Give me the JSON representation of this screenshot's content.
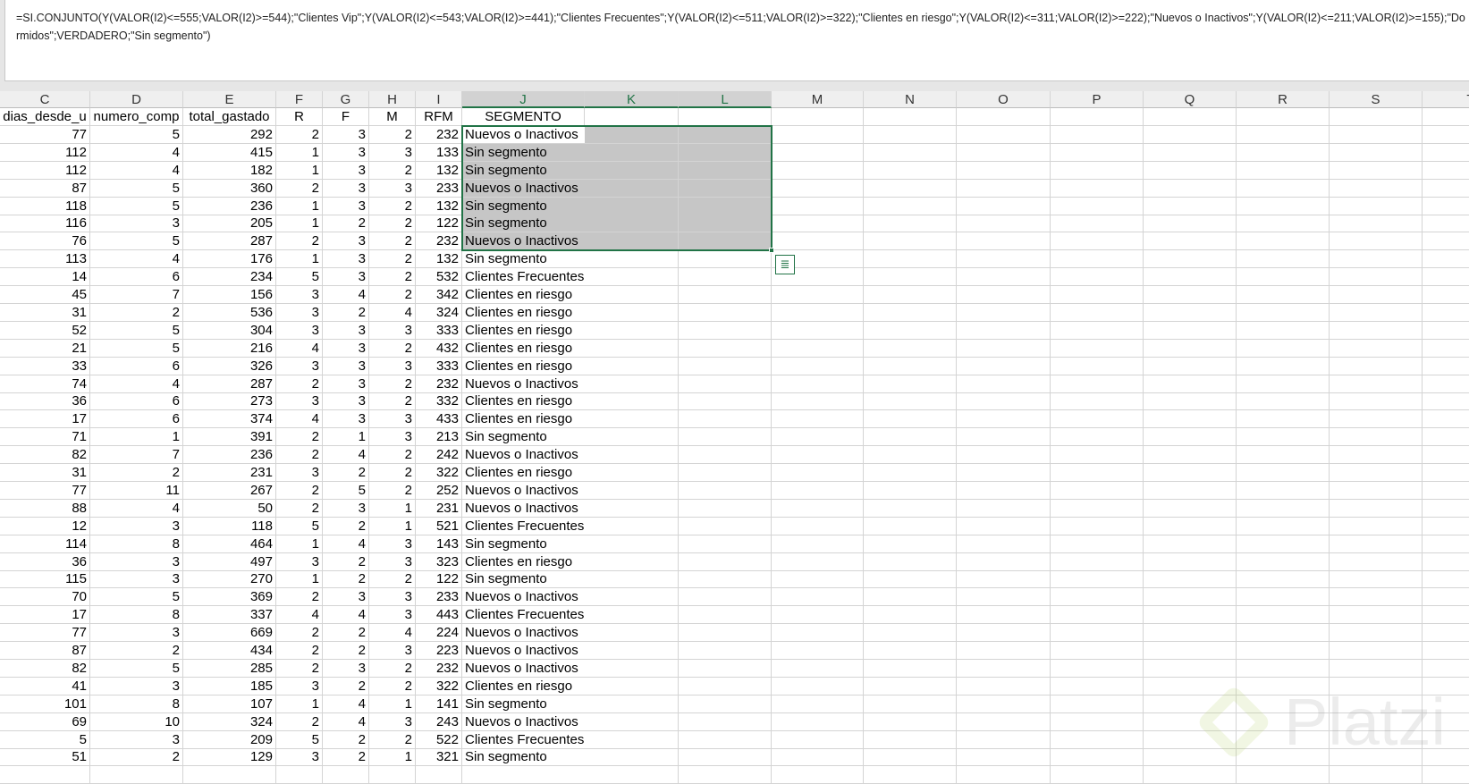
{
  "formula_bar": {
    "text": "=SI.CONJUNTO(Y(VALOR(I2)<=555;VALOR(I2)>=544);\"Clientes Vip\";Y(VALOR(I2)<=543;VALOR(I2)>=441);\"Clientes Frecuentes\";Y(VALOR(I2)<=511;VALOR(I2)>=322);\"Clientes en riesgo\";Y(VALOR(I2)<=311;VALOR(I2)>=222);\"Nuevos o Inactivos\";Y(VALOR(I2)<=211;VALOR(I2)>=155);\"Dormidos\";VERDADERO;\"Sin segmento\")"
  },
  "columns": [
    "C",
    "D",
    "E",
    "F",
    "G",
    "H",
    "I",
    "J",
    "K",
    "L",
    "M",
    "N",
    "O",
    "P",
    "Q",
    "R",
    "S",
    "T"
  ],
  "headers": [
    "dias_desde_u",
    "numero_comp",
    "total_gastado",
    "R",
    "F",
    "M",
    "RFM",
    "SEGMENTO"
  ],
  "rows": [
    [
      77,
      5,
      292,
      2,
      3,
      2,
      232,
      "Nuevos o Inactivos"
    ],
    [
      112,
      4,
      415,
      1,
      3,
      3,
      133,
      "Sin segmento"
    ],
    [
      112,
      4,
      182,
      1,
      3,
      2,
      132,
      "Sin segmento"
    ],
    [
      87,
      5,
      360,
      2,
      3,
      3,
      233,
      "Nuevos o Inactivos"
    ],
    [
      118,
      5,
      236,
      1,
      3,
      2,
      132,
      "Sin segmento"
    ],
    [
      116,
      3,
      205,
      1,
      2,
      2,
      122,
      "Sin segmento"
    ],
    [
      76,
      5,
      287,
      2,
      3,
      2,
      232,
      "Nuevos o Inactivos"
    ],
    [
      113,
      4,
      176,
      1,
      3,
      2,
      132,
      "Sin segmento"
    ],
    [
      14,
      6,
      234,
      5,
      3,
      2,
      532,
      "Clientes Frecuentes"
    ],
    [
      45,
      7,
      156,
      3,
      4,
      2,
      342,
      "Clientes en riesgo"
    ],
    [
      31,
      2,
      536,
      3,
      2,
      4,
      324,
      "Clientes en riesgo"
    ],
    [
      52,
      5,
      304,
      3,
      3,
      3,
      333,
      "Clientes en riesgo"
    ],
    [
      21,
      5,
      216,
      4,
      3,
      2,
      432,
      "Clientes en riesgo"
    ],
    [
      33,
      6,
      326,
      3,
      3,
      3,
      333,
      "Clientes en riesgo"
    ],
    [
      74,
      4,
      287,
      2,
      3,
      2,
      232,
      "Nuevos o Inactivos"
    ],
    [
      36,
      6,
      273,
      3,
      3,
      2,
      332,
      "Clientes en riesgo"
    ],
    [
      17,
      6,
      374,
      4,
      3,
      3,
      433,
      "Clientes en riesgo"
    ],
    [
      71,
      1,
      391,
      2,
      1,
      3,
      213,
      "Sin segmento"
    ],
    [
      82,
      7,
      236,
      2,
      4,
      2,
      242,
      "Nuevos o Inactivos"
    ],
    [
      31,
      2,
      231,
      3,
      2,
      2,
      322,
      "Clientes en riesgo"
    ],
    [
      77,
      11,
      267,
      2,
      5,
      2,
      252,
      "Nuevos o Inactivos"
    ],
    [
      88,
      4,
      50,
      2,
      3,
      1,
      231,
      "Nuevos o Inactivos"
    ],
    [
      12,
      3,
      118,
      5,
      2,
      1,
      521,
      "Clientes Frecuentes"
    ],
    [
      114,
      8,
      464,
      1,
      4,
      3,
      143,
      "Sin segmento"
    ],
    [
      36,
      3,
      497,
      3,
      2,
      3,
      323,
      "Clientes en riesgo"
    ],
    [
      115,
      3,
      270,
      1,
      2,
      2,
      122,
      "Sin segmento"
    ],
    [
      70,
      5,
      369,
      2,
      3,
      3,
      233,
      "Nuevos o Inactivos"
    ],
    [
      17,
      8,
      337,
      4,
      4,
      3,
      443,
      "Clientes Frecuentes"
    ],
    [
      77,
      3,
      669,
      2,
      2,
      4,
      224,
      "Nuevos o Inactivos"
    ],
    [
      87,
      2,
      434,
      2,
      2,
      3,
      223,
      "Nuevos o Inactivos"
    ],
    [
      82,
      5,
      285,
      2,
      3,
      2,
      232,
      "Nuevos o Inactivos"
    ],
    [
      41,
      3,
      185,
      3,
      2,
      2,
      322,
      "Clientes en riesgo"
    ],
    [
      101,
      8,
      107,
      1,
      4,
      1,
      141,
      "Sin segmento"
    ],
    [
      69,
      10,
      324,
      2,
      4,
      3,
      243,
      "Nuevos o Inactivos"
    ],
    [
      5,
      3,
      209,
      5,
      2,
      2,
      522,
      "Clientes Frecuentes"
    ],
    [
      51,
      2,
      129,
      3,
      2,
      1,
      321,
      "Sin segmento"
    ]
  ],
  "watermark": "Platzi",
  "colors": {
    "accent": "#217346",
    "selection": "#c6c6c6"
  }
}
